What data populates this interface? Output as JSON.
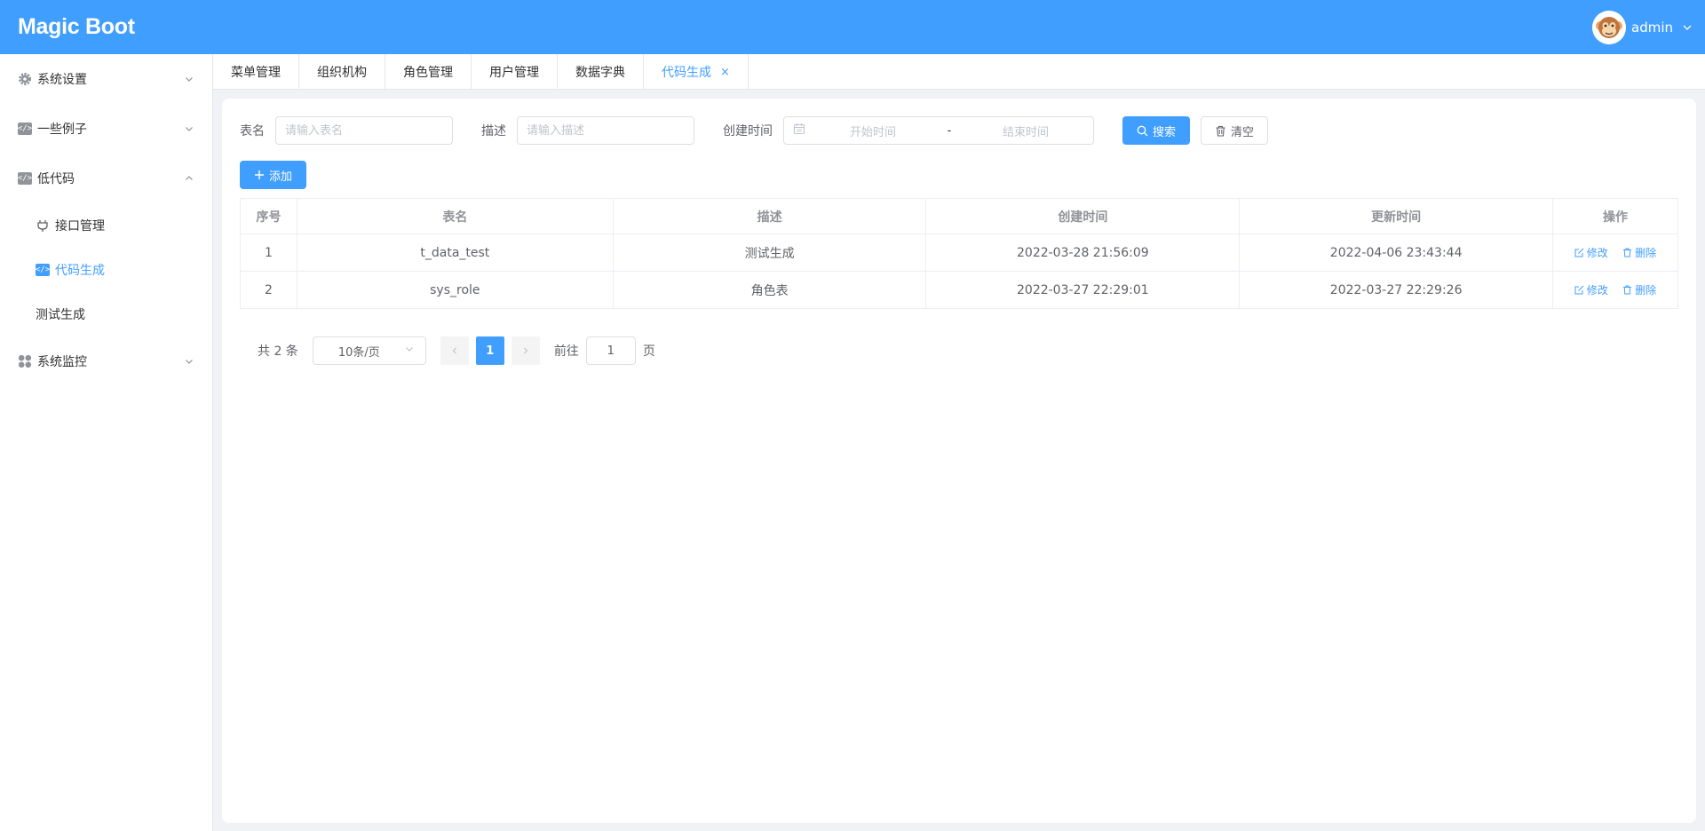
{
  "app": {
    "title": "Magic Boot",
    "user_name": "admin"
  },
  "sidebar": {
    "items": [
      {
        "label": "系统设置"
      },
      {
        "label": "一些例子"
      },
      {
        "label": "低代码",
        "expanded": true,
        "children": [
          {
            "label": "接口管理"
          },
          {
            "label": "代码生成",
            "active": true
          },
          {
            "label": "测试生成"
          }
        ]
      },
      {
        "label": "系统监控"
      }
    ]
  },
  "tabs": [
    {
      "label": "菜单管理"
    },
    {
      "label": "组织机构"
    },
    {
      "label": "角色管理"
    },
    {
      "label": "用户管理"
    },
    {
      "label": "数据字典"
    },
    {
      "label": "代码生成",
      "active": true,
      "close": "×"
    }
  ],
  "search": {
    "table_name_label": "表名",
    "table_name_placeholder": "请输入表名",
    "desc_label": "描述",
    "desc_placeholder": "请输入描述",
    "created_label": "创建时间",
    "start_placeholder": "开始时间",
    "range_sep": "-",
    "end_placeholder": "结束时间",
    "search_button": "搜索",
    "clear_button": "清空"
  },
  "toolbar": {
    "add_button": "添加"
  },
  "table": {
    "columns": [
      "序号",
      "表名",
      "描述",
      "创建时间",
      "更新时间",
      "操作"
    ],
    "rows": [
      {
        "index": "1",
        "name": "t_data_test",
        "desc": "测试生成",
        "created": "2022-03-28 21:56:09",
        "updated": "2022-04-06 23:43:44"
      },
      {
        "index": "2",
        "name": "sys_role",
        "desc": "角色表",
        "created": "2022-03-27 22:29:01",
        "updated": "2022-03-27 22:29:26"
      }
    ],
    "edit_label": "修改",
    "delete_label": "删除"
  },
  "pagination": {
    "total_text": "共 2 条",
    "page_size": "10条/页",
    "current_page": "1",
    "goto_label": "前往",
    "goto_value": "1",
    "page_suffix": "页"
  },
  "colors": {
    "primary": "#409eff",
    "header_bg": "#409eff",
    "body_bg": "#f0f2f5"
  }
}
